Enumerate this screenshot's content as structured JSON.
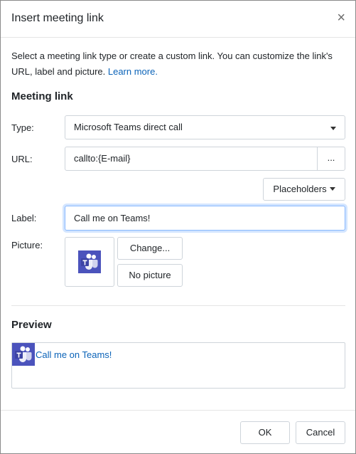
{
  "dialog": {
    "title": "Insert meeting link",
    "close_glyph": "×"
  },
  "intro": {
    "text": "Select a meeting link type or create a custom link. You can customize the link's URL, label and picture. ",
    "learn_more": "Learn more."
  },
  "meeting_link": {
    "heading": "Meeting link",
    "type_label": "Type:",
    "type_value": "Microsoft Teams direct call",
    "url_label": "URL:",
    "url_value": "callto:{E-mail}",
    "url_button": "...",
    "placeholders_button": "Placeholders",
    "label_label": "Label:",
    "label_value": "Call me on Teams!",
    "picture_label": "Picture:",
    "picture_icon": "microsoft-teams-icon",
    "change_button": "Change...",
    "no_picture_button": "No picture"
  },
  "preview": {
    "heading": "Preview",
    "link_text": "Call me on Teams!",
    "icon": "microsoft-teams-icon"
  },
  "footer": {
    "ok_button": "OK",
    "cancel_button": "Cancel"
  },
  "colors": {
    "teams_purple": "#4b53bc",
    "link_blue": "#0b63b8",
    "focus_border": "#86b7fe"
  }
}
